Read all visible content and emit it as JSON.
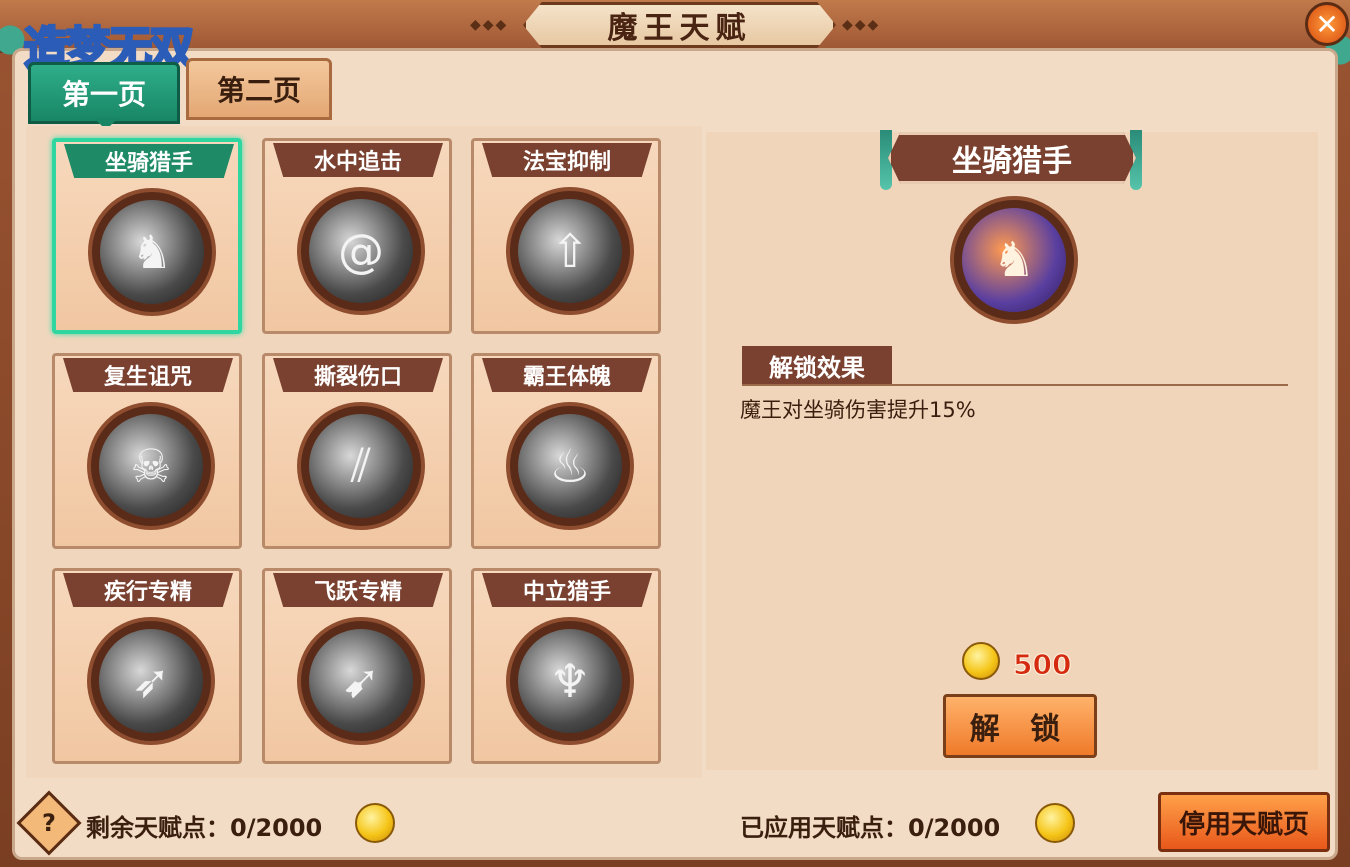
{
  "header": {
    "title": "魔王天赋",
    "logo_text": "造梦无双"
  },
  "tabs": [
    {
      "label": "第一页",
      "active": true
    },
    {
      "label": "第二页",
      "active": false
    }
  ],
  "talents": [
    {
      "label": "坐骑猎手",
      "icon": "horse-icon",
      "selected": true
    },
    {
      "label": "水中追击",
      "icon": "vortex-icon",
      "selected": false
    },
    {
      "label": "法宝抑制",
      "icon": "treasure-suppress-icon",
      "selected": false
    },
    {
      "label": "复生诅咒",
      "icon": "revive-curse-icon",
      "selected": false
    },
    {
      "label": "撕裂伤口",
      "icon": "claw-slash-icon",
      "selected": false
    },
    {
      "label": "霸王体魄",
      "icon": "flame-body-icon",
      "selected": false
    },
    {
      "label": "疾行专精",
      "icon": "dash-icon",
      "selected": false
    },
    {
      "label": "飞跃专精",
      "icon": "leap-icon",
      "selected": false
    },
    {
      "label": "中立猎手",
      "icon": "demon-mask-icon",
      "selected": false
    }
  ],
  "detail": {
    "title": "坐骑猎手",
    "icon": "horse-icon",
    "effect_header": "解锁效果",
    "effect_text": "魔王对坐骑伤害提升15%",
    "cost": "500",
    "unlock_label": "解 锁"
  },
  "footer": {
    "remaining_label": "剩余天赋点：0/2000",
    "applied_label": "已应用天赋点：0/2000",
    "disable_label": "停用天赋页"
  },
  "colors": {
    "accent_green": "#1f8a66",
    "banner_brown": "#7a4130",
    "cost_red": "#d42a10"
  }
}
